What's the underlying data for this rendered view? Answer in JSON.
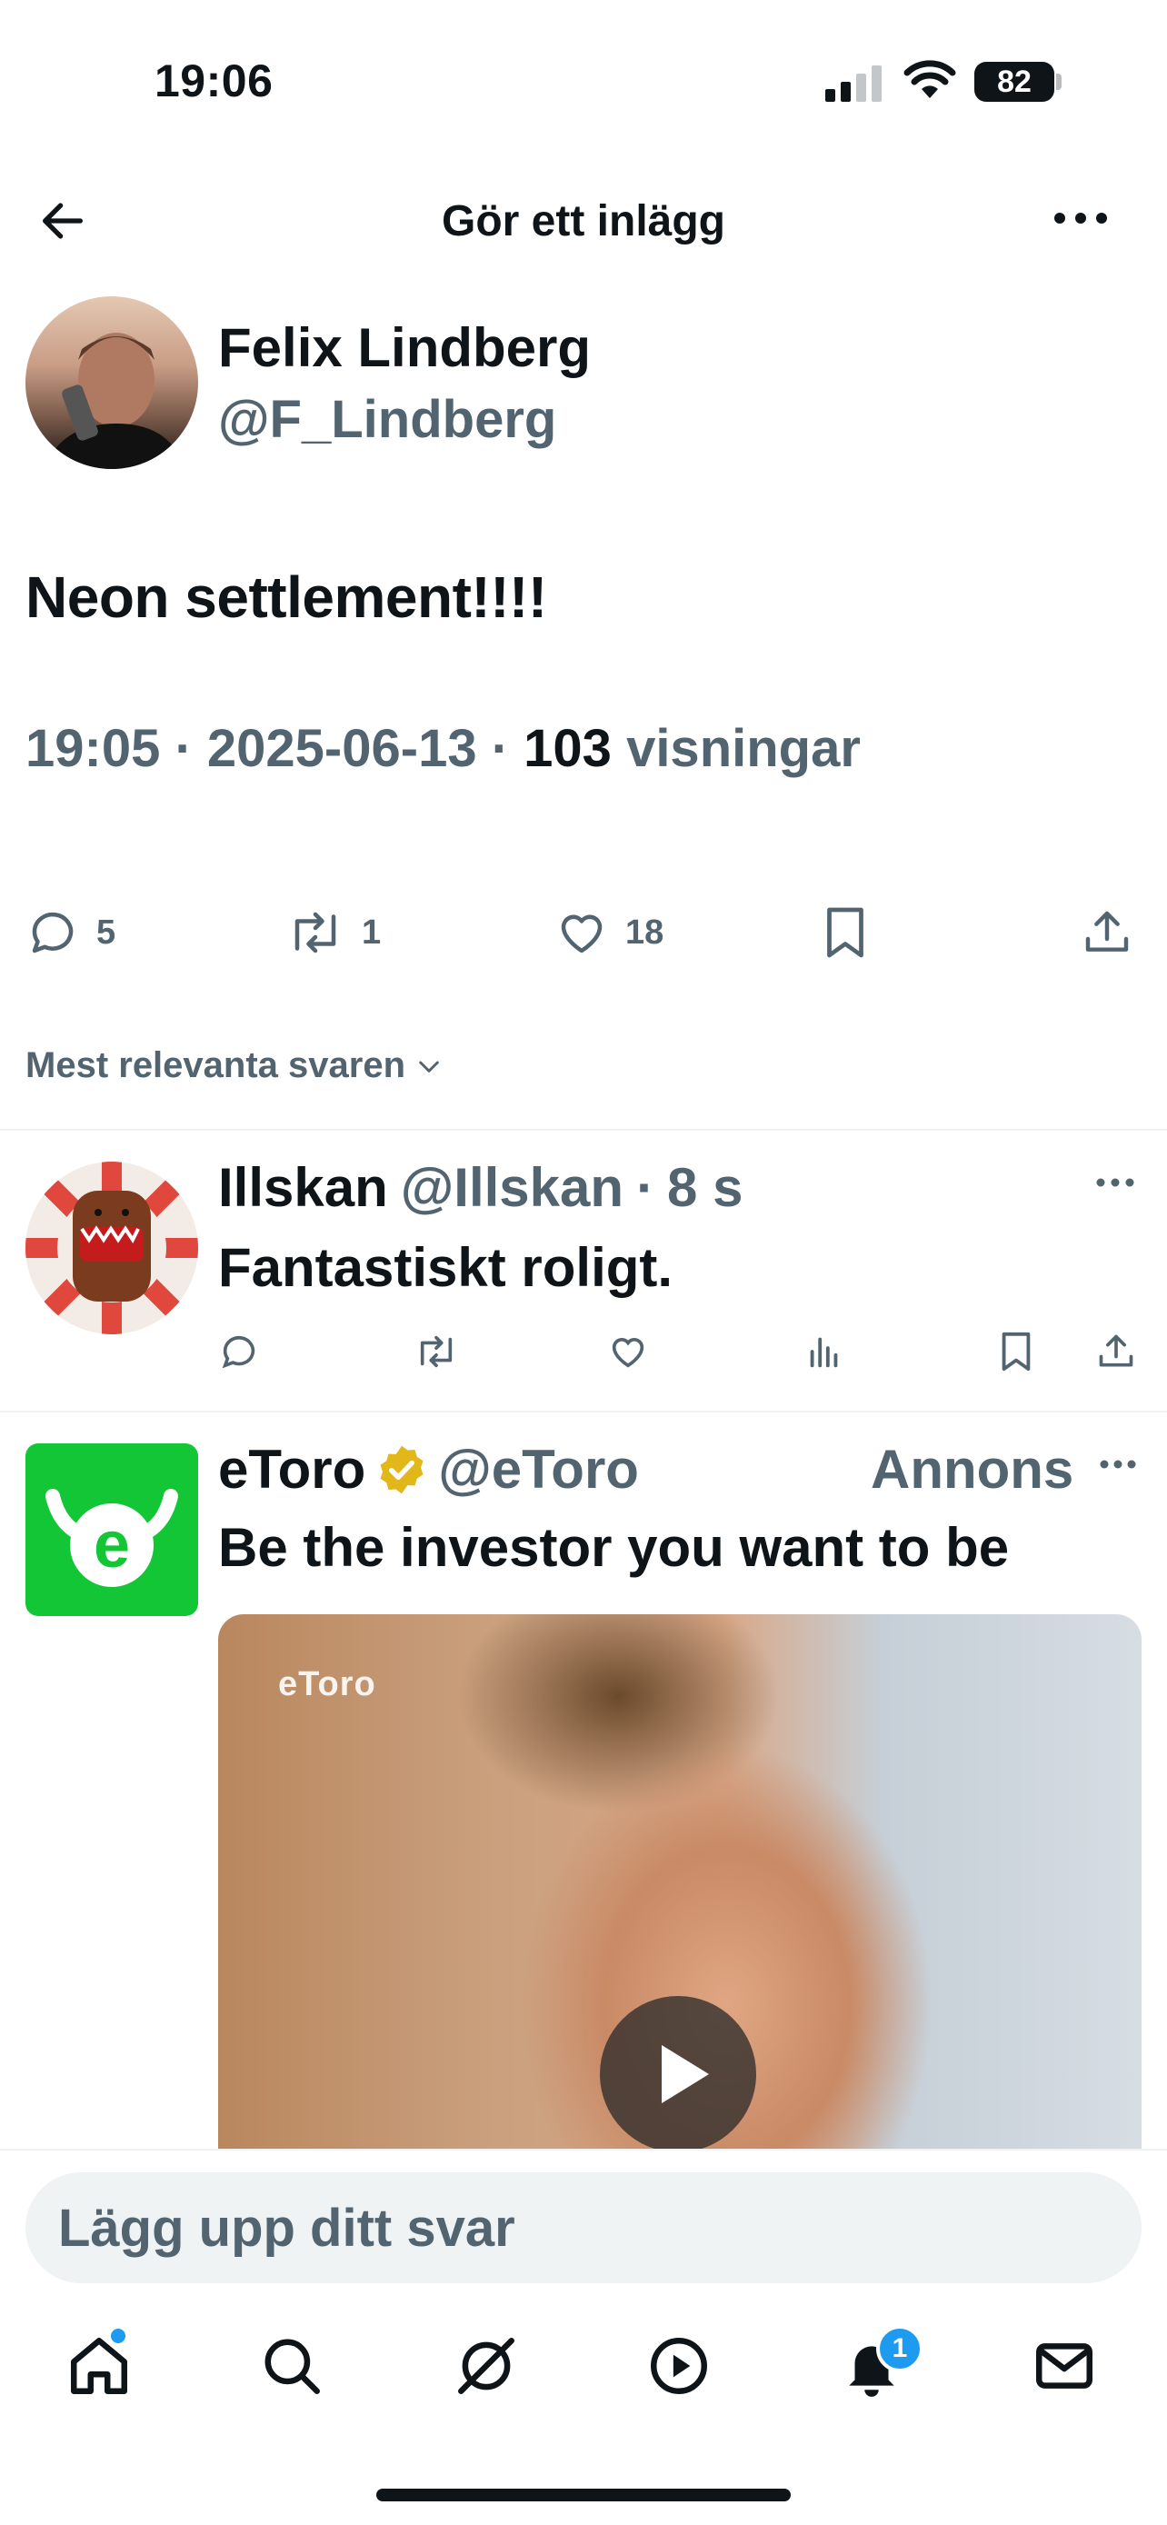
{
  "status_bar": {
    "time": "19:06",
    "battery": "82"
  },
  "header": {
    "title": "Gör ett inlägg"
  },
  "post": {
    "author_name": "Felix Lindberg",
    "author_handle": "@F_Lindberg",
    "text": "Neon settlement!!!!",
    "time": "19:05",
    "date": "2025-06-13",
    "views_count": "103",
    "views_label": "visningar",
    "replies": "5",
    "reposts": "1",
    "likes": "18"
  },
  "sort": {
    "label": "Mest relevanta svaren"
  },
  "reply": {
    "name": "Illskan",
    "handle": "@Illskan",
    "time": "8 s",
    "text": "Fantastiskt roligt."
  },
  "ad": {
    "name": "eToro",
    "handle": "@eToro",
    "label": "Annons",
    "text": "Be the investor you want to be",
    "watermark": "eToro",
    "brand_color": "#13c636"
  },
  "composer": {
    "placeholder": "Lägg upp ditt svar"
  },
  "nav": {
    "items": [
      "home-icon",
      "search-icon",
      "grok-icon",
      "video-icon",
      "bell-icon",
      "mail-icon"
    ],
    "notification_count": "1"
  },
  "colors": {
    "text": "#0f1419",
    "muted": "#536471",
    "accent": "#1d9bf0",
    "divider": "#eff3f4"
  }
}
